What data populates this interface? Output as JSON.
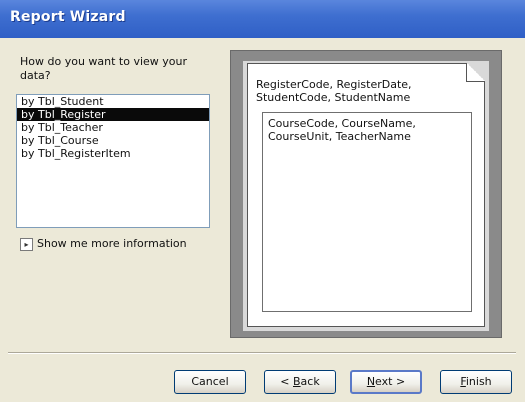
{
  "window": {
    "title": "Report Wizard"
  },
  "prompt": "How do you want to view your data?",
  "view_list": {
    "items": [
      {
        "label": "by Tbl_Student",
        "selected": false
      },
      {
        "label": "by Tbl_Register",
        "selected": true
      },
      {
        "label": "by Tbl_Teacher",
        "selected": false
      },
      {
        "label": "by Tbl_Course",
        "selected": false
      },
      {
        "label": "by Tbl_RegisterItem",
        "selected": false
      }
    ]
  },
  "more_info": {
    "label": "Show me more information"
  },
  "preview": {
    "group_fields": "RegisterCode, RegisterDate, StudentCode, StudentName",
    "detail_fields": "CourseCode, CourseName, CourseUnit, TeacherName"
  },
  "buttons": {
    "cancel": "Cancel",
    "back_prefix": "< ",
    "back_hotkey": "B",
    "back_rest": "ack",
    "next_hotkey": "N",
    "next_rest": "ext >",
    "finish_hotkey": "F",
    "finish_rest": "inish"
  }
}
